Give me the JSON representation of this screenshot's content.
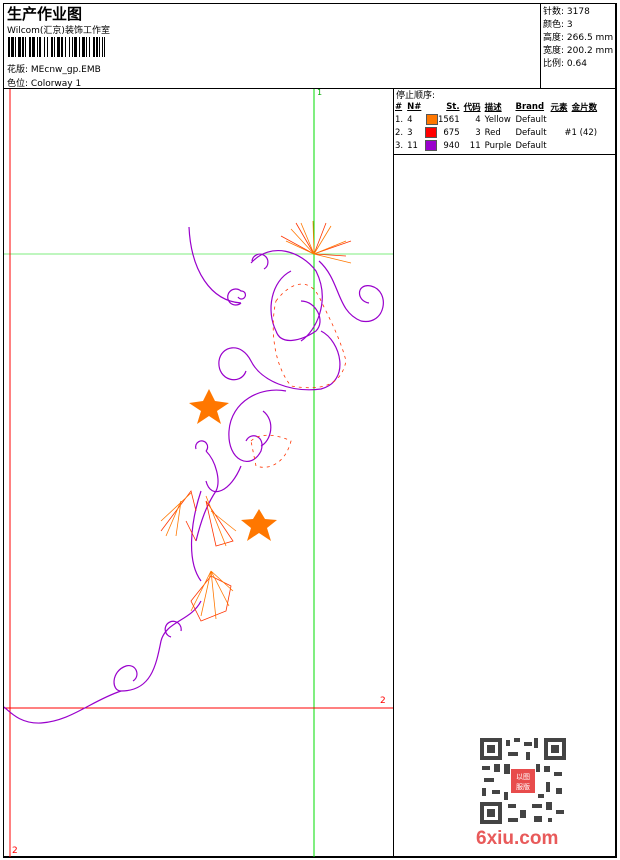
{
  "header": {
    "title": "生产作业图",
    "company": "Wilcom(汇京)装饰工作室",
    "design_label": "花版:",
    "design_value": "MEcnw_gp.EMB",
    "colorway_label": "色位:",
    "colorway_value": "Colorway 1"
  },
  "info": [
    {
      "label": "针数:",
      "value": "3178"
    },
    {
      "label": "颜色:",
      "value": "3"
    },
    {
      "label": "高度:",
      "value": "266.5 mm"
    },
    {
      "label": "宽度:",
      "value": "200.2 mm"
    },
    {
      "label": "比例:",
      "value": "0.64"
    }
  ],
  "stop_sequence": {
    "title": "停止顺序:",
    "headers": [
      "#",
      "N#",
      "St.",
      "代码",
      "描述",
      "Brand",
      "元素",
      "金片数"
    ],
    "rows": [
      {
        "idx": "1.",
        "n": "4",
        "color": "#ff7700",
        "st": "1561",
        "code": "4",
        "desc": "Yellow",
        "brand": "Default",
        "elem": ""
      },
      {
        "idx": "2.",
        "n": "3",
        "color": "#ff0000",
        "st": "675",
        "code": "3",
        "desc": "Red",
        "brand": "Default",
        "elem": "#1 (42)"
      },
      {
        "idx": "3.",
        "n": "11",
        "color": "#9900cc",
        "st": "940",
        "code": "11",
        "desc": "Purple",
        "brand": "Default",
        "elem": ""
      }
    ]
  },
  "guides": {
    "green_label": "1",
    "red_label_right": "2",
    "red_label_bottom": "2"
  },
  "watermark": {
    "text": "6xiu.com",
    "stamp": "以图服版"
  }
}
